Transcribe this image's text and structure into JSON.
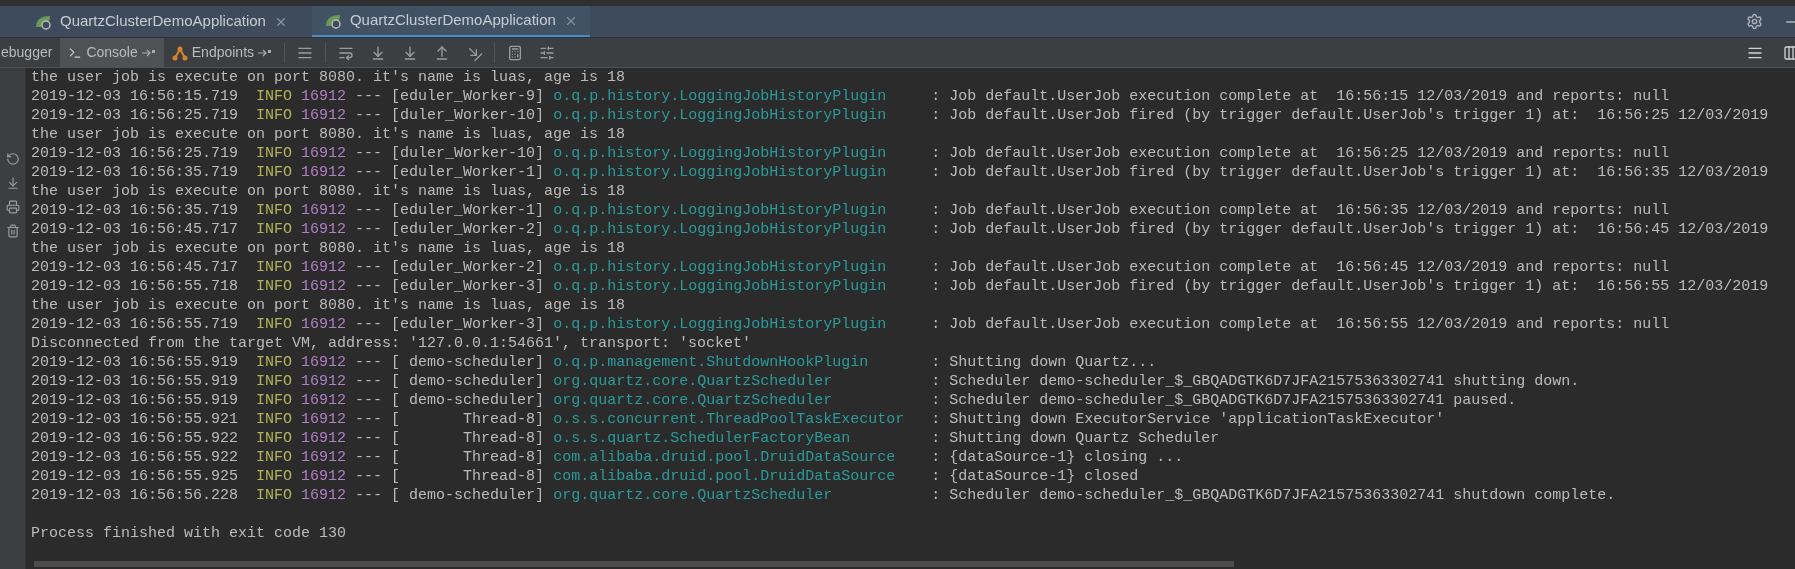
{
  "tabs": [
    {
      "label": "QuartzClusterDemoApplication",
      "selected": false
    },
    {
      "label": "QuartzClusterDemoApplication",
      "selected": true
    }
  ],
  "toolbar": {
    "tabs": [
      {
        "label": "ebugger",
        "selected": false
      },
      {
        "label": "Console",
        "selected": true
      },
      {
        "label": "Endpoints",
        "selected": false
      }
    ]
  },
  "console": {
    "lines": [
      {
        "kind": "plain",
        "text": "the user job is execute on port 8080. it's name is luas, age is 18"
      },
      {
        "kind": "log",
        "timestamp": "2019-12-03 16:56:15.719",
        "level": "INFO",
        "pid": "16912",
        "sep": "---",
        "thread": "[eduler_Worker-9]",
        "logger": "o.q.p.history.LoggingJobHistoryPlugin",
        "message": ": Job default.UserJob execution complete at  16:56:15 12/03/2019 and reports: null"
      },
      {
        "kind": "log",
        "timestamp": "2019-12-03 16:56:25.719",
        "level": "INFO",
        "pid": "16912",
        "sep": "---",
        "thread": "[duler_Worker-10]",
        "logger": "o.q.p.history.LoggingJobHistoryPlugin",
        "message": ": Job default.UserJob fired (by trigger default.UserJob's trigger 1) at:  16:56:25 12/03/2019"
      },
      {
        "kind": "plain",
        "text": "the user job is execute on port 8080. it's name is luas, age is 18"
      },
      {
        "kind": "log",
        "timestamp": "2019-12-03 16:56:25.719",
        "level": "INFO",
        "pid": "16912",
        "sep": "---",
        "thread": "[duler_Worker-10]",
        "logger": "o.q.p.history.LoggingJobHistoryPlugin",
        "message": ": Job default.UserJob execution complete at  16:56:25 12/03/2019 and reports: null"
      },
      {
        "kind": "log",
        "timestamp": "2019-12-03 16:56:35.719",
        "level": "INFO",
        "pid": "16912",
        "sep": "---",
        "thread": "[eduler_Worker-1]",
        "logger": "o.q.p.history.LoggingJobHistoryPlugin",
        "message": ": Job default.UserJob fired (by trigger default.UserJob's trigger 1) at:  16:56:35 12/03/2019"
      },
      {
        "kind": "plain",
        "text": "the user job is execute on port 8080. it's name is luas, age is 18"
      },
      {
        "kind": "log",
        "timestamp": "2019-12-03 16:56:35.719",
        "level": "INFO",
        "pid": "16912",
        "sep": "---",
        "thread": "[eduler_Worker-1]",
        "logger": "o.q.p.history.LoggingJobHistoryPlugin",
        "message": ": Job default.UserJob execution complete at  16:56:35 12/03/2019 and reports: null"
      },
      {
        "kind": "log",
        "timestamp": "2019-12-03 16:56:45.717",
        "level": "INFO",
        "pid": "16912",
        "sep": "---",
        "thread": "[eduler_Worker-2]",
        "logger": "o.q.p.history.LoggingJobHistoryPlugin",
        "message": ": Job default.UserJob fired (by trigger default.UserJob's trigger 1) at:  16:56:45 12/03/2019"
      },
      {
        "kind": "plain",
        "text": "the user job is execute on port 8080. it's name is luas, age is 18"
      },
      {
        "kind": "log",
        "timestamp": "2019-12-03 16:56:45.717",
        "level": "INFO",
        "pid": "16912",
        "sep": "---",
        "thread": "[eduler_Worker-2]",
        "logger": "o.q.p.history.LoggingJobHistoryPlugin",
        "message": ": Job default.UserJob execution complete at  16:56:45 12/03/2019 and reports: null"
      },
      {
        "kind": "log",
        "timestamp": "2019-12-03 16:56:55.718",
        "level": "INFO",
        "pid": "16912",
        "sep": "---",
        "thread": "[eduler_Worker-3]",
        "logger": "o.q.p.history.LoggingJobHistoryPlugin",
        "message": ": Job default.UserJob fired (by trigger default.UserJob's trigger 1) at:  16:56:55 12/03/2019"
      },
      {
        "kind": "plain",
        "text": "the user job is execute on port 8080. it's name is luas, age is 18"
      },
      {
        "kind": "log",
        "timestamp": "2019-12-03 16:56:55.719",
        "level": "INFO",
        "pid": "16912",
        "sep": "---",
        "thread": "[eduler_Worker-3]",
        "logger": "o.q.p.history.LoggingJobHistoryPlugin",
        "message": ": Job default.UserJob execution complete at  16:56:55 12/03/2019 and reports: null"
      },
      {
        "kind": "plain",
        "text": "Disconnected from the target VM, address: '127.0.0.1:54661', transport: 'socket'"
      },
      {
        "kind": "log",
        "timestamp": "2019-12-03 16:56:55.919",
        "level": "INFO",
        "pid": "16912",
        "sep": "---",
        "thread": "[ demo-scheduler]",
        "logger": "o.q.p.management.ShutdownHookPlugin",
        "message": ": Shutting down Quartz..."
      },
      {
        "kind": "log",
        "timestamp": "2019-12-03 16:56:55.919",
        "level": "INFO",
        "pid": "16912",
        "sep": "---",
        "thread": "[ demo-scheduler]",
        "logger": "org.quartz.core.QuartzScheduler",
        "message": ": Scheduler demo-scheduler_$_GBQADGTK6D7JFA21575363302741 shutting down."
      },
      {
        "kind": "log",
        "timestamp": "2019-12-03 16:56:55.919",
        "level": "INFO",
        "pid": "16912",
        "sep": "---",
        "thread": "[ demo-scheduler]",
        "logger": "org.quartz.core.QuartzScheduler",
        "message": ": Scheduler demo-scheduler_$_GBQADGTK6D7JFA21575363302741 paused."
      },
      {
        "kind": "log",
        "timestamp": "2019-12-03 16:56:55.921",
        "level": "INFO",
        "pid": "16912",
        "sep": "---",
        "thread": "[       Thread-8]",
        "logger": "o.s.s.concurrent.ThreadPoolTaskExecutor",
        "message": ": Shutting down ExecutorService 'applicationTaskExecutor'"
      },
      {
        "kind": "log",
        "timestamp": "2019-12-03 16:56:55.922",
        "level": "INFO",
        "pid": "16912",
        "sep": "---",
        "thread": "[       Thread-8]",
        "logger": "o.s.s.quartz.SchedulerFactoryBean",
        "message": ": Shutting down Quartz Scheduler"
      },
      {
        "kind": "log",
        "timestamp": "2019-12-03 16:56:55.922",
        "level": "INFO",
        "pid": "16912",
        "sep": "---",
        "thread": "[       Thread-8]",
        "logger": "com.alibaba.druid.pool.DruidDataSource",
        "message": ": {dataSource-1} closing ..."
      },
      {
        "kind": "log",
        "timestamp": "2019-12-03 16:56:55.925",
        "level": "INFO",
        "pid": "16912",
        "sep": "---",
        "thread": "[       Thread-8]",
        "logger": "com.alibaba.druid.pool.DruidDataSource",
        "message": ": {dataSource-1} closed"
      },
      {
        "kind": "log",
        "timestamp": "2019-12-03 16:56:56.228",
        "level": "INFO",
        "pid": "16912",
        "sep": "---",
        "thread": "[ demo-scheduler]",
        "logger": "org.quartz.core.QuartzScheduler",
        "message": ": Scheduler demo-scheduler_$_GBQADGTK6D7JFA21575363302741 shutdown complete."
      },
      {
        "kind": "blank"
      },
      {
        "kind": "plain",
        "text": "Process finished with exit code 130"
      }
    ]
  }
}
